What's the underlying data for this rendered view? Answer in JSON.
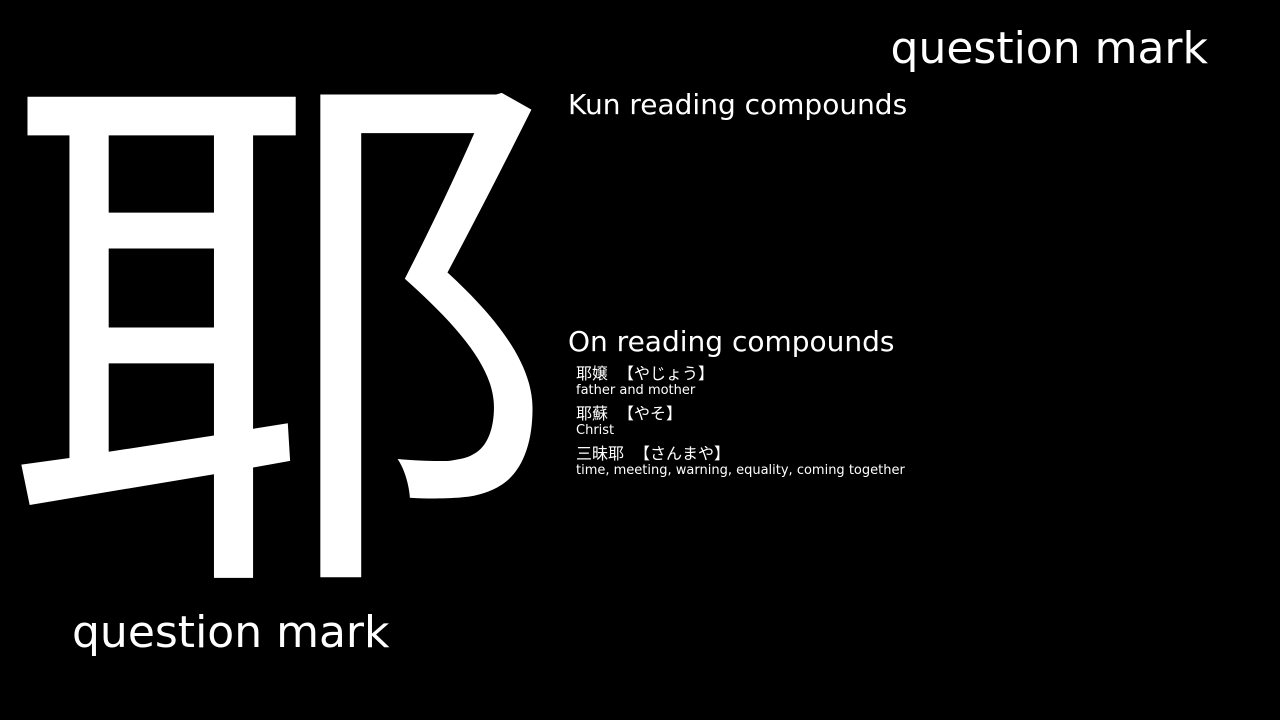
{
  "kanji": {
    "character": "耶"
  },
  "meaning": "question mark",
  "kun_section": {
    "heading": "Kun reading compounds",
    "items": []
  },
  "on_section": {
    "heading": "On reading compounds",
    "items": [
      {
        "word": "耶嬢",
        "reading": "【やじょう】",
        "gloss": "father and mother"
      },
      {
        "word": "耶蘇",
        "reading": "【やそ】",
        "gloss": "Christ"
      },
      {
        "word": "三昧耶",
        "reading": "【さんまや】",
        "gloss": "time, meeting, warning, equality, coming together"
      }
    ]
  },
  "colors": {
    "background": "#000000",
    "text": "#ffffff"
  }
}
